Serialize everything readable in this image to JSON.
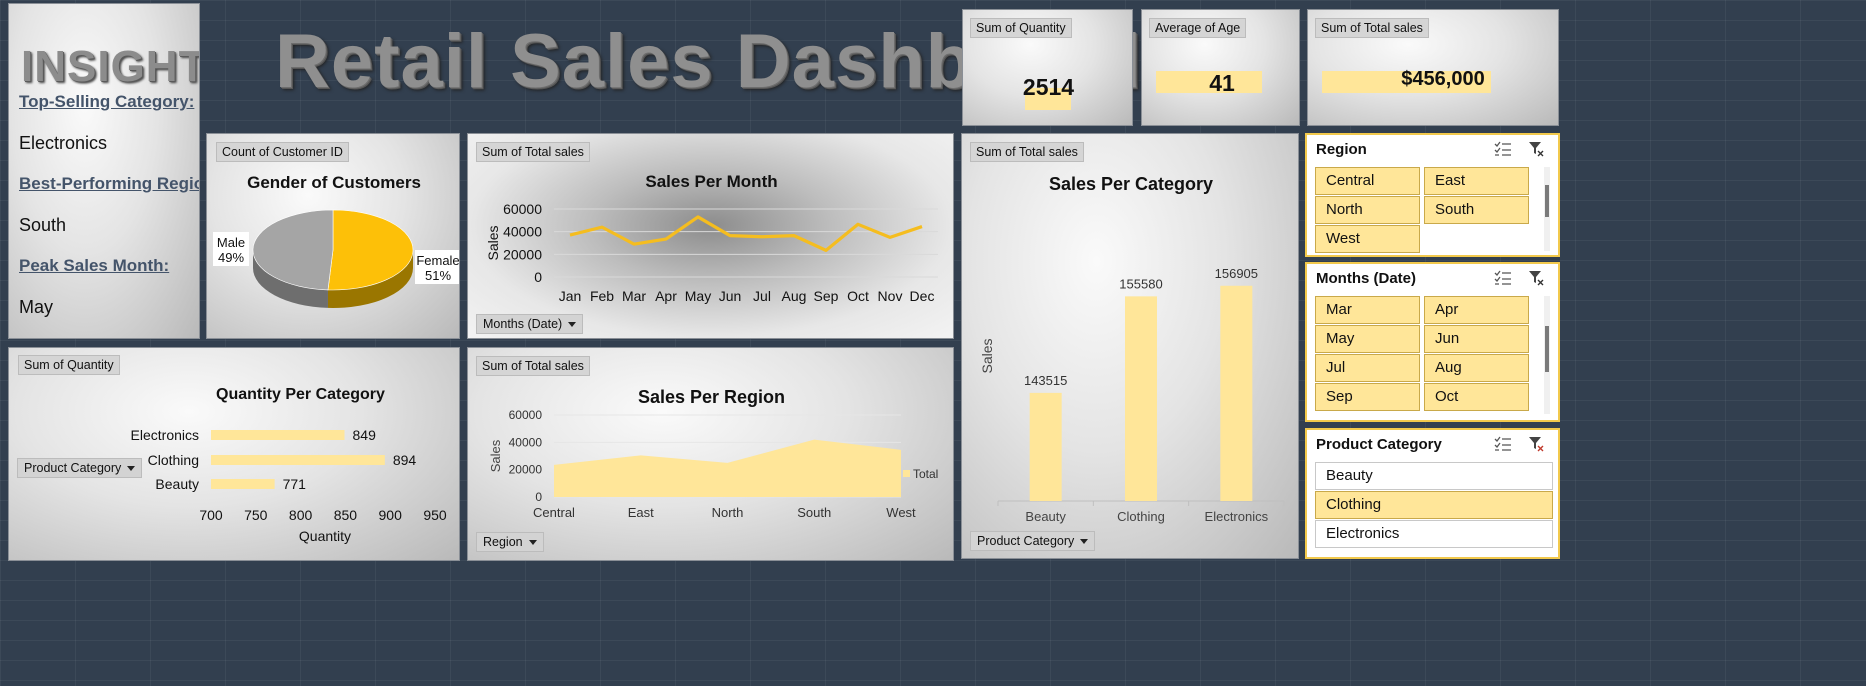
{
  "insight": {
    "title": "INSIGHT",
    "top_category_label": "Top-Selling Category:",
    "top_category_value": "Electronics",
    "best_region_label": "Best-Performing Region:",
    "best_region_value": "South",
    "peak_month_label": "Peak Sales Month:",
    "peak_month_value": "May"
  },
  "dashboard_title": "Retail Sales Dashboard",
  "kpis": {
    "quantity_label": "Sum of Quantity",
    "quantity_value": "2514",
    "age_label": "Average of Age",
    "age_value": "41",
    "sales_label": "Sum of Total sales",
    "sales_value": "$456,000"
  },
  "colors": {
    "pie_female": "#fdc008",
    "pie_male": "#a5a5a5",
    "line": "#f5bd1f",
    "bar": "#ffe699",
    "area": "#ffe699",
    "slicer_selected": "#ffe699",
    "slicer_border": "#f2c94c",
    "label_dark": "#44546a"
  },
  "field_tags": {
    "gender": "Count of Customer ID",
    "month": "Sum of Total sales",
    "category_sales": "Sum of Total sales",
    "quantity": "Sum of Quantity",
    "region": "Sum of Total sales"
  },
  "dropdowns": {
    "months": "Months (Date)",
    "quantity_category": "Product Category",
    "region": "Region",
    "category_sales": "Product Category"
  },
  "chart_data": [
    {
      "id": "gender",
      "type": "pie",
      "title": "Gender of Customers",
      "slices": [
        {
          "name": "Female",
          "label": "Female",
          "pct": "51%",
          "value": 51
        },
        {
          "name": "Male",
          "label": "Male",
          "pct": "49%",
          "value": 49
        }
      ]
    },
    {
      "id": "month",
      "type": "line",
      "title": "Sales Per Month",
      "ylabel": "Sales",
      "ylim": [
        0,
        60000
      ],
      "yticks": [
        "0",
        "20000",
        "40000",
        "60000"
      ],
      "categories": [
        "Jan",
        "Feb",
        "Mar",
        "Apr",
        "May",
        "Jun",
        "Jul",
        "Aug",
        "Sep",
        "Oct",
        "Nov",
        "Dec"
      ],
      "values": [
        37000,
        44000,
        29000,
        33500,
        53000,
        36500,
        35500,
        36500,
        23500,
        46500,
        35000,
        44500
      ]
    },
    {
      "id": "category_sales",
      "type": "bar",
      "title": "Sales Per Category",
      "ylabel": "Sales",
      "ylim": [
        0,
        160000
      ],
      "categories": [
        "Beauty",
        "Clothing",
        "Electronics"
      ],
      "values": [
        143515,
        155580,
        156905
      ],
      "data_labels": [
        "143515",
        "155580",
        "156905"
      ]
    },
    {
      "id": "quantity",
      "type": "bar",
      "orientation": "horizontal",
      "title": "Quantity Per Category",
      "xlabel": "Quantity",
      "xlim": [
        700,
        950
      ],
      "xticks": [
        "700",
        "750",
        "800",
        "850",
        "900",
        "950"
      ],
      "categories": [
        "Electronics",
        "Clothing",
        "Beauty"
      ],
      "values": [
        849,
        894,
        771
      ],
      "data_labels": [
        "849",
        "894",
        "771"
      ]
    },
    {
      "id": "region",
      "type": "area",
      "title": "Sales Per Region",
      "ylabel": "Sales",
      "ylim": [
        0,
        60000
      ],
      "yticks": [
        "0",
        "20000",
        "40000",
        "60000"
      ],
      "categories": [
        "Central",
        "East",
        "North",
        "South",
        "West"
      ],
      "series": [
        {
          "name": "Total",
          "values": [
            23500,
            30500,
            25000,
            42000,
            34500
          ]
        }
      ],
      "legend": "right"
    }
  ],
  "slicers": {
    "region": {
      "title": "Region",
      "items": [
        "Central",
        "East",
        "North",
        "South",
        "West"
      ]
    },
    "months": {
      "title": "Months (Date)",
      "items": [
        "Mar",
        "Apr",
        "May",
        "Jun",
        "Jul",
        "Aug",
        "Sep",
        "Oct"
      ]
    },
    "category": {
      "title": "Product Category",
      "items": [
        "Beauty",
        "Clothing",
        "Electronics"
      ],
      "selected": [
        "Clothing"
      ]
    }
  }
}
